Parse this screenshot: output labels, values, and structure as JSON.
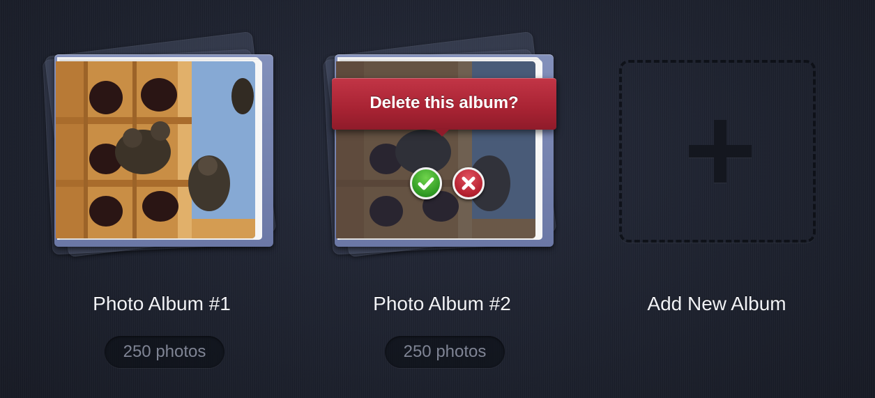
{
  "albums": [
    {
      "title": "Photo Album #1",
      "count": "250 photos"
    },
    {
      "title": "Photo Album #2",
      "count": "250 photos",
      "delete_prompt": "Delete this album?"
    }
  ],
  "add_album": {
    "label": "Add New Album"
  },
  "colors": {
    "background": "#1e2230",
    "cover": "#7a86b2",
    "tooltip": "#a82333",
    "confirm": "#2f9a23",
    "cancel": "#b4202f"
  },
  "icons": {
    "confirm": "checkmark-icon",
    "cancel": "close-icon",
    "add": "plus-icon"
  }
}
